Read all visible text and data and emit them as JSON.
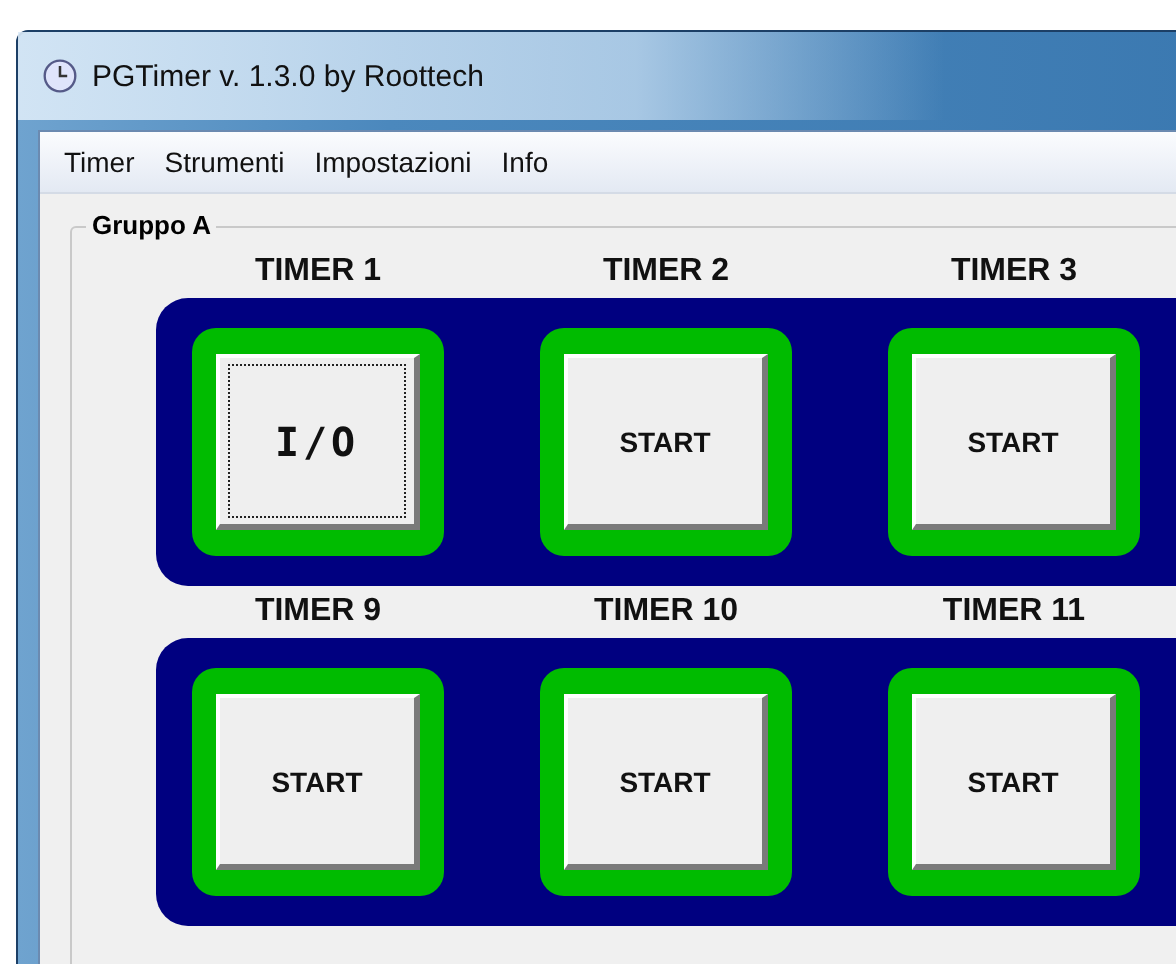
{
  "window": {
    "title": "PGTimer  v. 1.3.0  by Roottech"
  },
  "menu": [
    "Timer",
    "Strumenti",
    "Impostazioni",
    "Info"
  ],
  "group": {
    "title": "Gruppo A",
    "rows": [
      {
        "timers": [
          {
            "label": "TIMER  1",
            "button": "I/O",
            "focused": true
          },
          {
            "label": "TIMER  2",
            "button": "START",
            "focused": false
          },
          {
            "label": "TIMER  3",
            "button": "START",
            "focused": false
          }
        ]
      },
      {
        "timers": [
          {
            "label": "TIMER  9",
            "button": "START",
            "focused": false
          },
          {
            "label": "TIMER 10",
            "button": "START",
            "focused": false
          },
          {
            "label": "TIMER 11",
            "button": "START",
            "focused": false
          }
        ]
      }
    ]
  }
}
